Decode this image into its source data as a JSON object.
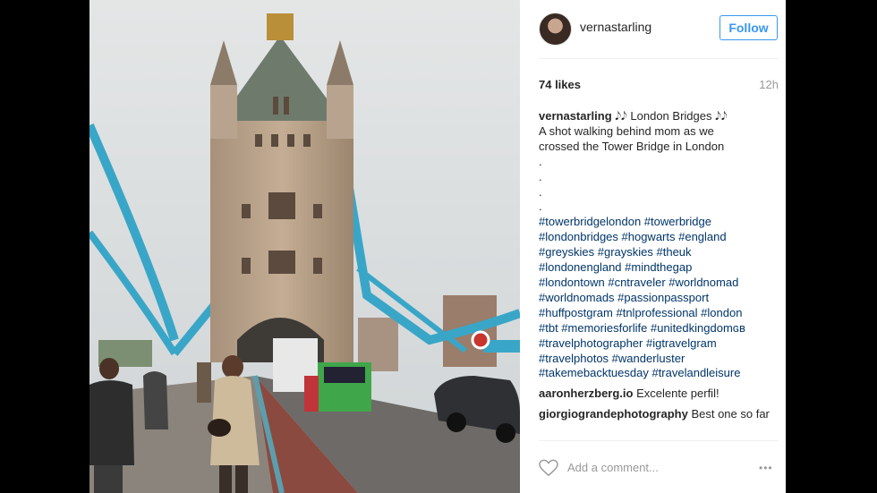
{
  "header": {
    "username": "vernastarling",
    "follow_label": "Follow"
  },
  "stats": {
    "likes": "74 likes",
    "time": "12h"
  },
  "caption": {
    "author": "vernastarling",
    "title": " 𝅘𝅥𝅮𝅘𝅥𝅮 London Bridges 𝅘𝅥𝅮𝅘𝅥𝅮",
    "text_lines": [
      "A shot walking behind mom as we",
      "crossed the Tower Bridge in London"
    ],
    "dots": [
      ".",
      ".",
      ".",
      "."
    ],
    "hashtag_lines": [
      "#towerbridgelondon #towerbridge",
      "#londonbridges #hogwarts #england",
      "#greyskies #grayskies #theuk",
      "#londonengland #mindthegap",
      "#londontown #cntraveler #worldnomad",
      "#worldnomads #passionpassport",
      "#huffpostgram #tnlprofessional #london",
      "#tbt #memoriesforlife #unitedkingdomɢʙ",
      "#travelphotographer #igtravelgram",
      "#travelphotos #wanderluster",
      "#takemebacktuesday #travelandleisure"
    ]
  },
  "comments": [
    {
      "author": "aaronherzberg.io",
      "text": " Excelente perfil!"
    },
    {
      "author": "giorgiograndephotography",
      "text": " Best one so far"
    }
  ],
  "footer": {
    "add_comment_placeholder": "Add a comment...",
    "more_label": "•••",
    "icons": [
      "heart-icon",
      "more-options-icon"
    ]
  },
  "colors": {
    "follow_blue": "#3897f0",
    "hashtag": "#003569",
    "bridge_blue": "#39a6c8"
  }
}
